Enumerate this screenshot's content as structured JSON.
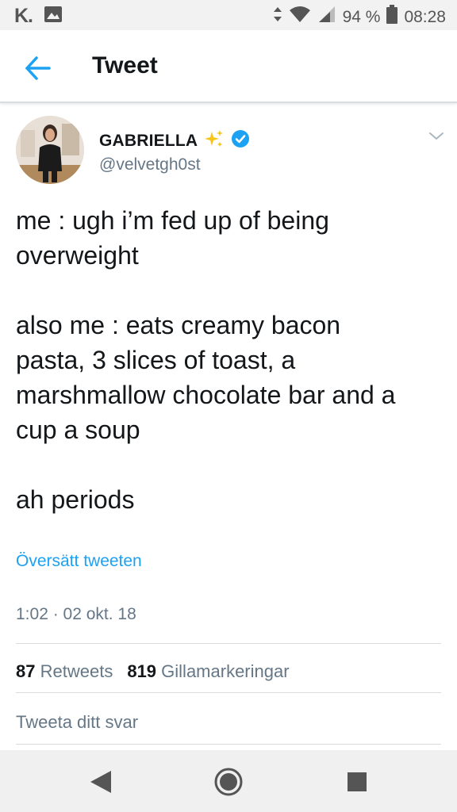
{
  "status_bar": {
    "app_icon": "K.",
    "battery": "94 %",
    "time": "08:28"
  },
  "app_bar": {
    "title": "Tweet"
  },
  "tweet": {
    "display_name": "GABRIELLA",
    "sparkle_emoji": "✨",
    "handle": "@velvetgh0st",
    "text_lines": [
      "me : ugh i’m fed up of being",
      "overweight",
      "",
      "also me : eats creamy bacon",
      "pasta, 3 slices of toast, a",
      "marshmallow chocolate bar and a",
      "cup a soup",
      "",
      "ah periods"
    ],
    "translate_label": "Översätt tweeten",
    "timestamp": "1:02 · 02 okt. 18",
    "retweets_count": "87",
    "retweets_label": "Retweets",
    "likes_count": "819",
    "likes_label": "Gillamarkeringar",
    "reply_placeholder": "Tweeta ditt svar"
  },
  "colors": {
    "accent": "#1da1f2",
    "secondary_text": "#657786",
    "primary_text": "#14171a",
    "divider": "#d9dde0"
  }
}
